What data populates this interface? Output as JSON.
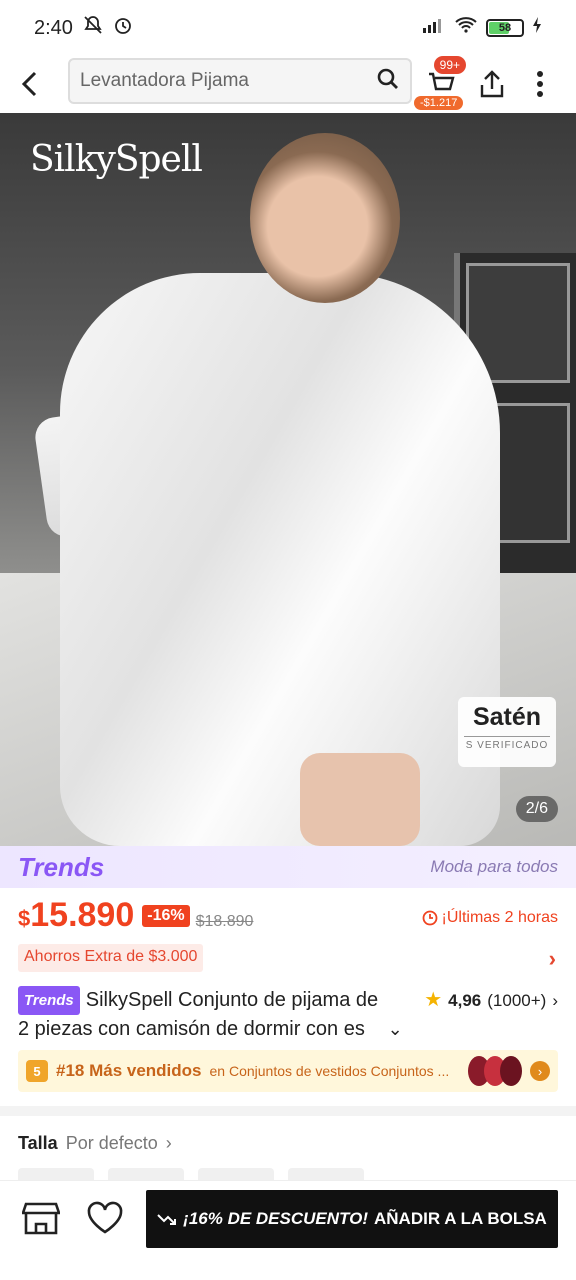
{
  "status_bar": {
    "time": "2:40",
    "battery": "58"
  },
  "search": {
    "query": "Levantadora Pijama"
  },
  "cart": {
    "count_badge": "99+",
    "price_badge": "-$1.217"
  },
  "hero": {
    "brand": "SilkySpell",
    "material_label": "Satén",
    "material_sub": "S VERIFICADO",
    "pager": "2/6"
  },
  "trends": {
    "logo": "Trends",
    "tagline": "Moda para todos"
  },
  "price": {
    "currency": "$",
    "amount": "15.890",
    "discount": "-16%",
    "original": "$18.890",
    "timer": "¡Últimas 2 horas"
  },
  "savings": {
    "text": "Ahorros Extra de $3.000"
  },
  "product": {
    "tag": "Trends",
    "title_line1": "SilkySpell Conjunto de pijama de",
    "title_line2": "2 piezas con camisón de dormir con es",
    "rating": "4,96",
    "reviews": "(1000+)"
  },
  "bestseller": {
    "rank": "#18 Más vendidos",
    "category": "en Conjuntos de vestidos Conjuntos ..."
  },
  "size": {
    "label": "Talla",
    "value": "Por defecto"
  },
  "cta": {
    "promo": "¡16% DE DESCUENTO!",
    "action": "AÑADIR A LA BOLSA"
  },
  "colors": {
    "accent": "#f0421f",
    "trends_purple": "#8a57f5"
  }
}
